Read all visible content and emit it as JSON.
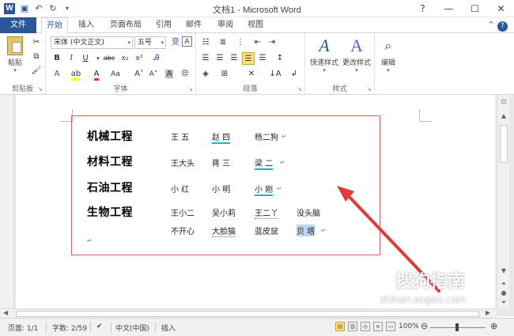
{
  "titlebar": {
    "title": "文档1 - Microsoft Word",
    "qat": [
      "save-icon",
      "undo-icon",
      "redo-icon"
    ]
  },
  "tabs": [
    "文件",
    "开始",
    "插入",
    "页面布局",
    "引用",
    "邮件",
    "审阅",
    "视图"
  ],
  "ribbon": {
    "clipboard": {
      "paste_label": "粘贴",
      "group_label": "剪贴板"
    },
    "font": {
      "font_name": "宋体 (中文正文)",
      "font_size": "五号",
      "group_label": "字体"
    },
    "paragraph": {
      "group_label": "段落"
    },
    "styles": {
      "quick_styles": "快速样式",
      "change_styles": "更改样式",
      "group_label": "样式"
    },
    "editing": {
      "label": "编辑"
    }
  },
  "document": {
    "rows": [
      {
        "category": "机械工程",
        "names": [
          "王 五",
          "赵 四",
          "杨二狗"
        ]
      },
      {
        "category": "材料工程",
        "names": [
          "王大头",
          "蒋 三",
          "梁 二"
        ]
      },
      {
        "category": "石油工程",
        "names": [
          "小 红",
          "小 明",
          "小 刚"
        ]
      },
      {
        "category": "生物工程",
        "names": [
          "王小二",
          "吴小莉",
          "王二丫",
          "没头脑"
        ]
      },
      {
        "category": "",
        "names": [
          "不开心",
          "大脸猫",
          "蓝皮鼠",
          "贝 塔"
        ]
      }
    ]
  },
  "statusbar": {
    "page": "页面: 1/1",
    "words": "字数: 2/59",
    "language": "中文(中国)",
    "mode": "插入",
    "zoom": "100%"
  },
  "watermark": {
    "text": "搜狗指南",
    "url": "zhinan.sogou.com"
  }
}
